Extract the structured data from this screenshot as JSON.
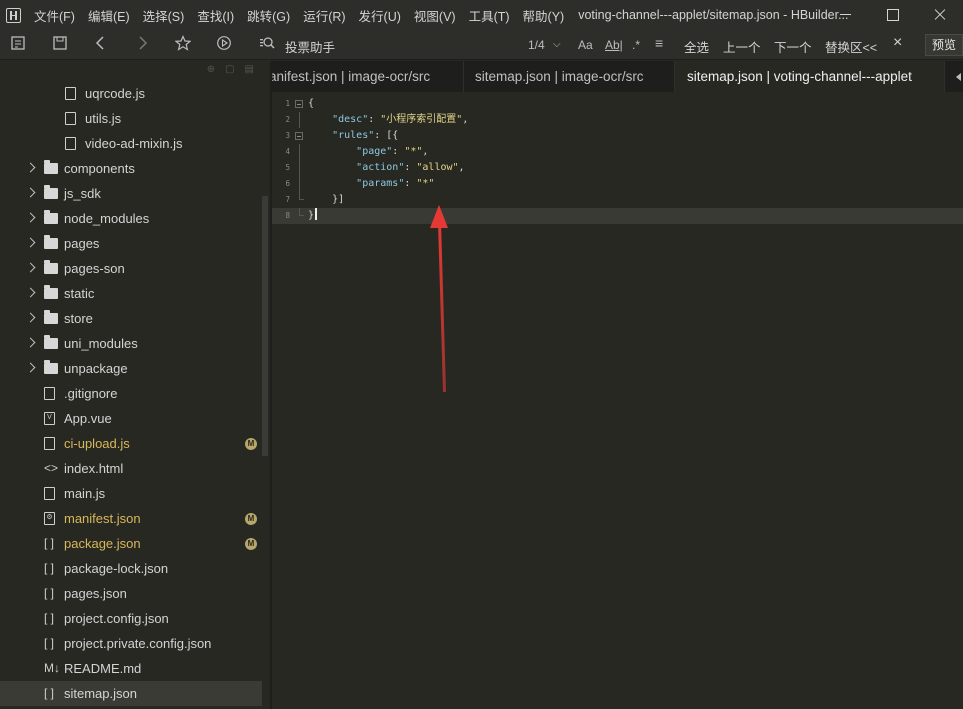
{
  "menu": [
    "文件(F)",
    "编辑(E)",
    "选择(S)",
    "查找(I)",
    "跳转(G)",
    "运行(R)",
    "发行(U)",
    "视图(V)",
    "工具(T)",
    "帮助(Y)"
  ],
  "window_title": "voting-channel---applet/sitemap.json - HBuilder...",
  "toolbar": {
    "icons": [
      "outline-icon",
      "save-icon",
      "back-icon",
      "forward-icon",
      "star-icon",
      "run-icon",
      "search-icon"
    ],
    "project_name": "投票助手",
    "match_count": "1/4",
    "opt_case": "Aa",
    "opt_word": "Ab|",
    "opt_regex": ".*",
    "opt_lines": "≡",
    "select_all": "全选",
    "prev": "上一个",
    "next": "下一个",
    "replace": "替换区<<",
    "close": "×",
    "preview": "预览"
  },
  "file_tree": [
    {
      "name": "uqrcode.js",
      "kind": "file",
      "icon_glyph": "",
      "icon": "js-file-icon",
      "depth": 2
    },
    {
      "name": "utils.js",
      "kind": "file",
      "icon_glyph": "",
      "icon": "js-file-icon",
      "depth": 2
    },
    {
      "name": "video-ad-mixin.js",
      "kind": "file",
      "icon_glyph": "",
      "icon": "js-file-icon",
      "depth": 2
    },
    {
      "name": "components",
      "kind": "folder",
      "icon": "folder-icon",
      "depth": 1
    },
    {
      "name": "js_sdk",
      "kind": "folder",
      "icon": "folder-icon",
      "depth": 1
    },
    {
      "name": "node_modules",
      "kind": "folder",
      "icon": "folder-icon",
      "depth": 1
    },
    {
      "name": "pages",
      "kind": "folder",
      "icon": "folder-icon",
      "depth": 1
    },
    {
      "name": "pages-son",
      "kind": "folder",
      "icon": "folder-icon",
      "depth": 1
    },
    {
      "name": "static",
      "kind": "folder",
      "icon": "folder-icon",
      "depth": 1
    },
    {
      "name": "store",
      "kind": "folder",
      "icon": "folder-icon",
      "depth": 1
    },
    {
      "name": "uni_modules",
      "kind": "folder",
      "icon": "folder-icon",
      "depth": 1
    },
    {
      "name": "unpackage",
      "kind": "folder",
      "icon": "folder-icon",
      "depth": 1
    },
    {
      "name": ".gitignore",
      "kind": "file",
      "icon_glyph": "",
      "icon": "gitignore-file-icon",
      "depth": 1
    },
    {
      "name": "App.vue",
      "kind": "file",
      "icon_glyph": "V",
      "icon": "vue-file-icon",
      "depth": 1
    },
    {
      "name": "ci-upload.js",
      "kind": "file",
      "icon_glyph": "",
      "icon": "js-file-icon",
      "depth": 1,
      "modified": true,
      "badge": "M"
    },
    {
      "name": "index.html",
      "kind": "text",
      "icon_glyph": "<>",
      "icon": "html-file-icon",
      "depth": 1
    },
    {
      "name": "main.js",
      "kind": "file",
      "icon_glyph": "",
      "icon": "js-file-icon",
      "depth": 1
    },
    {
      "name": "manifest.json",
      "kind": "file",
      "icon_glyph": "⚙",
      "icon": "manifest-file-icon",
      "depth": 1,
      "modified": true,
      "badge": "M"
    },
    {
      "name": "package.json",
      "kind": "text",
      "icon_glyph": "[ ]",
      "icon": "json-file-icon",
      "depth": 1,
      "modified": true,
      "badge": "M"
    },
    {
      "name": "package-lock.json",
      "kind": "text",
      "icon_glyph": "[ ]",
      "icon": "json-file-icon",
      "depth": 1
    },
    {
      "name": "pages.json",
      "kind": "text",
      "icon_glyph": "[ ]",
      "icon": "json-file-icon",
      "depth": 1
    },
    {
      "name": "project.config.json",
      "kind": "text",
      "icon_glyph": "[ ]",
      "icon": "json-file-icon",
      "depth": 1
    },
    {
      "name": "project.private.config.json",
      "kind": "text",
      "icon_glyph": "[ ]",
      "icon": "json-file-icon",
      "depth": 1
    },
    {
      "name": "README.md",
      "kind": "text",
      "icon_glyph": "M↓",
      "icon": "markdown-file-icon",
      "depth": 1
    },
    {
      "name": "sitemap.json",
      "kind": "text",
      "icon_glyph": "[ ]",
      "icon": "json-file-icon",
      "depth": 1,
      "selected": true
    }
  ],
  "tabs": [
    {
      "label": "anifest.json | image-ocr/src",
      "active": false
    },
    {
      "label": "sitemap.json | image-ocr/src",
      "active": false
    },
    {
      "label": "sitemap.json | voting-channel---applet",
      "active": true
    }
  ],
  "editor": {
    "lines": [
      {
        "num": "1",
        "fold": "open"
      },
      {
        "num": "2",
        "fold": "guide"
      },
      {
        "num": "3",
        "fold": "open"
      },
      {
        "num": "4",
        "fold": "guide"
      },
      {
        "num": "5",
        "fold": "guide"
      },
      {
        "num": "6",
        "fold": "guide"
      },
      {
        "num": "7",
        "fold": "end"
      },
      {
        "num": "8",
        "fold": "end",
        "current": true
      }
    ],
    "tokens": {
      "l1_brace": "{",
      "l2_key": "\"desc\"",
      "l2_val": "\"小程序索引配置\"",
      "l3_key": "\"rules\"",
      "l3_rest": ": [{",
      "l4_key": "\"page\"",
      "l4_val": "\"*\"",
      "l5_key": "\"action\"",
      "l5_val": "\"allow\"",
      "l6_key": "\"params\"",
      "l6_val": "\"*\"",
      "l7_close": "}]",
      "l8_close": "}"
    }
  },
  "annotation": {
    "shape": "red-arrow",
    "color": "#e53935"
  },
  "colors": {
    "bg": "#272822",
    "key": "#8fc7e3",
    "string": "#e4d58a",
    "modified_badge": "#b8a66a"
  }
}
